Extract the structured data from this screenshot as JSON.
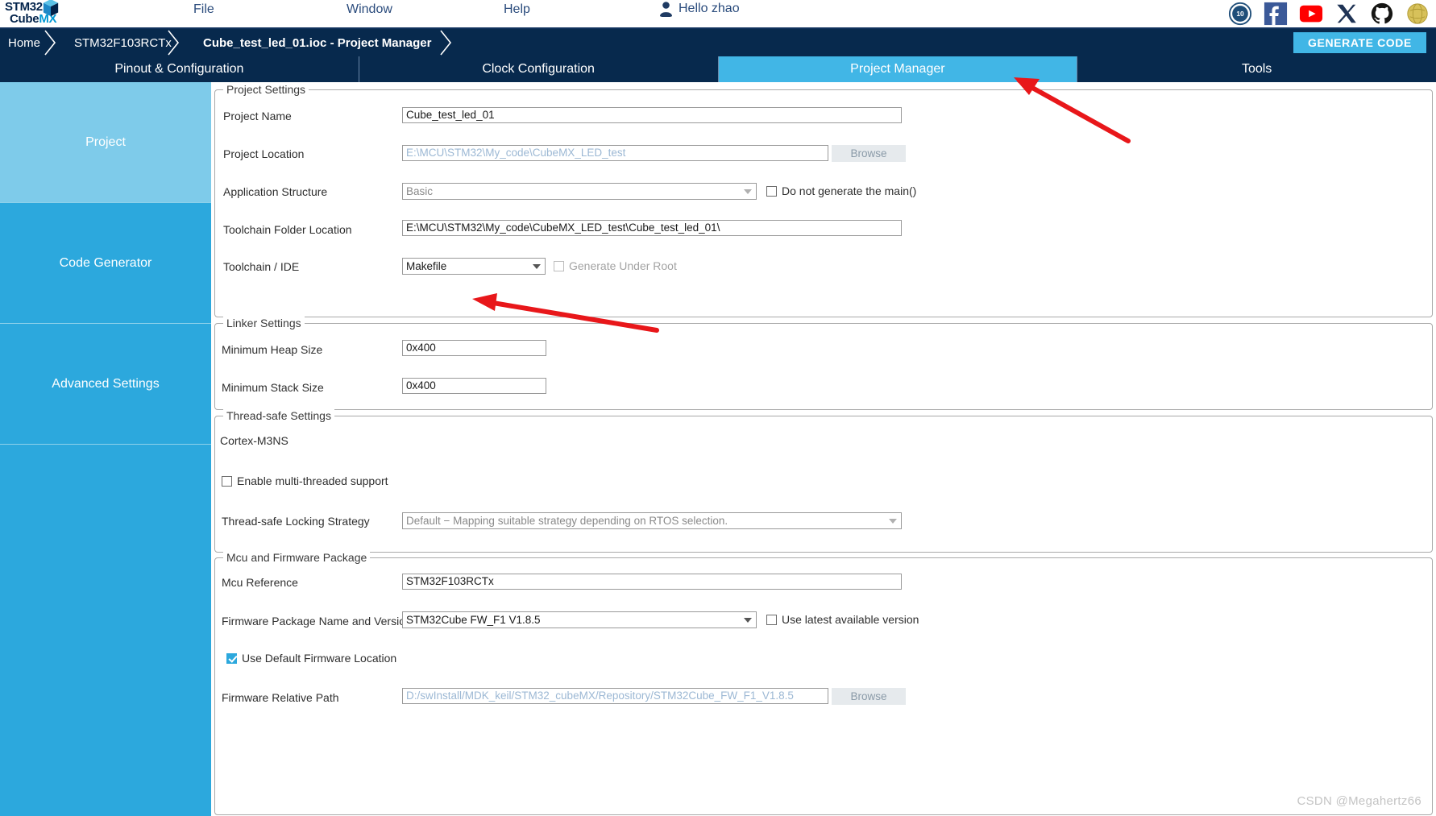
{
  "app": {
    "logo_line1": "STM32",
    "logo_line1_suffix": "",
    "logo_line2_a": "Cube",
    "logo_line2_b": "MX",
    "watermark": "CSDN @Megahertz66"
  },
  "menu": {
    "file": "File",
    "window": "Window",
    "help": "Help",
    "greeting": "Hello zhao"
  },
  "social_icons": [
    "ten-years-badge-icon",
    "facebook-icon",
    "youtube-icon",
    "x-twitter-icon",
    "github-icon",
    "wiki-globe-icon"
  ],
  "breadcrumb": {
    "items": [
      {
        "label": "Home",
        "active": false
      },
      {
        "label": "STM32F103RCTx",
        "active": false
      },
      {
        "label": "Cube_test_led_01.ioc - Project Manager",
        "active": true
      }
    ],
    "generate_code": "GENERATE CODE"
  },
  "tabs": [
    {
      "label": "Pinout & Configuration",
      "selected": false
    },
    {
      "label": "Clock Configuration",
      "selected": false
    },
    {
      "label": "Project Manager",
      "selected": true
    },
    {
      "label": "Tools",
      "selected": false
    }
  ],
  "sidebar": {
    "items": [
      {
        "label": "Project",
        "active": true
      },
      {
        "label": "Code Generator",
        "active": false
      },
      {
        "label": "Advanced Settings",
        "active": false
      },
      {
        "label": "",
        "active": false
      }
    ]
  },
  "project_settings": {
    "group_title": "Project Settings",
    "project_name": {
      "label": "Project Name",
      "value": "Cube_test_led_01"
    },
    "project_location": {
      "label": "Project Location",
      "value": "E:\\MCU\\STM32\\My_code\\CubeMX_LED_test",
      "browse": "Browse"
    },
    "application_structure": {
      "label": "Application Structure",
      "value": "Basic",
      "checkbox_label": "Do not generate the main()",
      "checked": false
    },
    "toolchain_folder_location": {
      "label": "Toolchain Folder Location",
      "value": "E:\\MCU\\STM32\\My_code\\CubeMX_LED_test\\Cube_test_led_01\\"
    },
    "toolchain_ide": {
      "label": "Toolchain / IDE",
      "value": "Makefile",
      "checkbox_label": "Generate Under Root",
      "checked": false
    }
  },
  "linker_settings": {
    "group_title": "Linker Settings",
    "min_heap": {
      "label": "Minimum Heap Size",
      "value": "0x400"
    },
    "min_stack": {
      "label": "Minimum Stack Size",
      "value": "0x400"
    }
  },
  "thread_safe_settings": {
    "group_title": "Thread-safe Settings",
    "core_label": "Cortex-M3NS",
    "enable_multithread": {
      "label": "Enable multi-threaded support",
      "checked": false
    },
    "locking_strategy": {
      "label": "Thread-safe Locking Strategy",
      "value": "Default  −  Mapping suitable strategy depending on RTOS selection."
    }
  },
  "mcu_firmware": {
    "group_title": "Mcu and Firmware Package",
    "mcu_reference": {
      "label": "Mcu Reference",
      "value": "STM32F103RCTx"
    },
    "firmware_package": {
      "label": "Firmware Package Name and Version",
      "value": "STM32Cube FW_F1 V1.8.5",
      "checkbox_label": "Use latest available version",
      "checked": false
    },
    "use_default_location": {
      "label": "Use Default Firmware Location",
      "checked": true
    },
    "firmware_relative_path": {
      "label": "Firmware Relative Path",
      "value": "D:/swInstall/MDK_keil/STM32_cubeMX/Repository/STM32Cube_FW_F1_V1.8.5",
      "browse": "Browse"
    }
  },
  "colors": {
    "brand_dark": "#07294d",
    "brand_accent": "#41b6e6",
    "sidebar": "#2ca8dd",
    "sidebar_active": "#7ecbea",
    "annotation": "#e8171a"
  }
}
